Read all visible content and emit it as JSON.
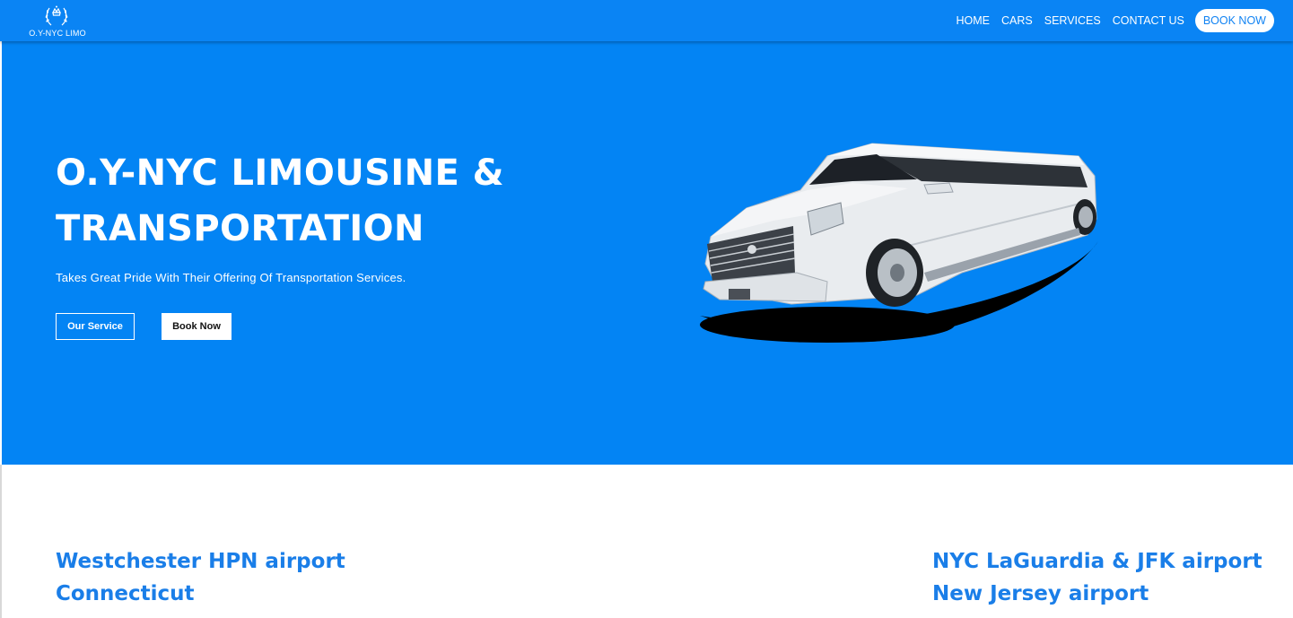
{
  "nav": {
    "logo_text": "O.Y-NYC LIMO",
    "links": [
      "HOME",
      "CARS",
      "SERVICES",
      "CONTACT US"
    ],
    "cta": "BOOK NOW"
  },
  "hero": {
    "title_line1": "O.Y-NYC LIMOUSINE &",
    "title_line2": "TRANSPORTATION",
    "subtitle": "Takes Great Pride With Their Offering Of Transportation Services.",
    "btn_service": "Our Service",
    "btn_book": "Book Now"
  },
  "locations": {
    "left": [
      "Westchester HPN airport",
      "Connecticut"
    ],
    "right": [
      "NYC LaGuardia & JFK airport",
      "New Jersey airport"
    ]
  },
  "colors": {
    "nav_bg": "#0a84f4",
    "hero_bg": "#0384f4",
    "accent_text": "#1a7ee8"
  }
}
